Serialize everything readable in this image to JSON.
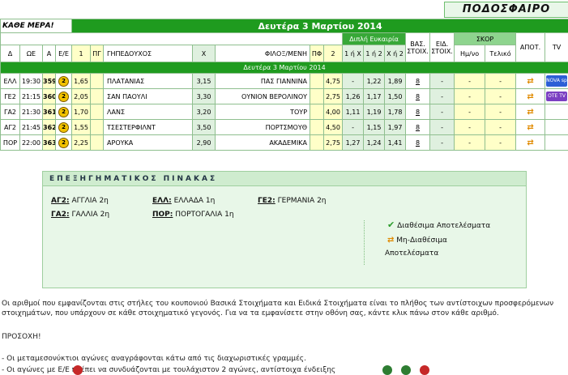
{
  "logo": "ΠΟΔΟΣΦΑΙΡΟ",
  "header": {
    "kathe_mera": "ΚΑΘΕ ΜΕΡΑ!",
    "title": "Δευτέρα 3 Μαρτίου 2014",
    "diplh": "Διπλή Ευκαιρία",
    "vas": "ΒΑΣ. ΣΤΟΙΧ.",
    "eid": "ΕΙΔ. ΣΤΟΙΧ.",
    "skor": "ΣΚΟΡ",
    "apot": "ΑΠΟΤ.",
    "tv": "TV",
    "date_row": "Δευτέρα 3 Μαρτίου 2014"
  },
  "columns": [
    "Δ",
    "ΩΕ",
    "Α",
    "Ε/Ε",
    "1",
    "ΠΓ",
    "ΓΗΠΕΔΟΥΧΟΣ",
    "Χ",
    "ΦΙΛΟΞ/ΜΕΝΗ",
    "ΠΦ",
    "2",
    "1 ή Χ",
    "1 ή 2",
    "Χ ή 2",
    "Ημ/νο",
    "Τελικό"
  ],
  "rows": [
    {
      "d": "ΕΛΛ",
      "time": "19:30",
      "code": "359",
      "ee": "2",
      "o1": "1,65",
      "home": "ΠΛΑΤΑΝΙΑΣ",
      "ox": "3,15",
      "away": "ΠΑΣ ΓΙΑΝΝΙΝΑ",
      "o2": "4,75",
      "dx1": "-",
      "d12": "1,22",
      "dx2": "1,89",
      "vas": "8",
      "eid": "-",
      "half": "-",
      "final": "-",
      "tv": "NOVA sports"
    },
    {
      "d": "ΓΕ2",
      "time": "21:15",
      "code": "360",
      "ee": "2",
      "o1": "2,05",
      "home": "ΣΑΝ ΠΑΟΥΛΙ",
      "ox": "3,30",
      "away": "ΟΥΝΙΟΝ ΒΕΡΟΛΙΝΟΥ",
      "o2": "2,75",
      "dx1": "1,26",
      "d12": "1,17",
      "dx2": "1,50",
      "vas": "8",
      "eid": "-",
      "half": "-",
      "final": "-",
      "tv": "OTE TV"
    },
    {
      "d": "ΓΑ2",
      "time": "21:30",
      "code": "361",
      "ee": "2",
      "o1": "1,70",
      "home": "ΛΑΝΣ",
      "ox": "3,20",
      "away": "ΤΟΥΡ",
      "o2": "4,00",
      "dx1": "1,11",
      "d12": "1,19",
      "dx2": "1,78",
      "vas": "8",
      "eid": "-",
      "half": "-",
      "final": "-",
      "tv": ""
    },
    {
      "d": "ΑΓ2",
      "time": "21:45",
      "code": "362",
      "ee": "2",
      "o1": "1,55",
      "home": "ΤΣΕΣΤΕΡΦΙΛΝΤ",
      "ox": "3,50",
      "away": "ΠΟΡΤΣΜΟΥΘ",
      "o2": "4,50",
      "dx1": "-",
      "d12": "1,15",
      "dx2": "1,97",
      "vas": "8",
      "eid": "-",
      "half": "-",
      "final": "-",
      "tv": ""
    },
    {
      "d": "ΠΟΡ",
      "time": "22:00",
      "code": "363",
      "ee": "2",
      "o1": "2,25",
      "home": "ΑΡΟΥΚΑ",
      "ox": "2,90",
      "away": "ΑΚΑΔΕΜΙΚΑ",
      "o2": "2,75",
      "dx1": "1,27",
      "d12": "1,24",
      "dx2": "1,41",
      "vas": "8",
      "eid": "-",
      "half": "-",
      "final": "-",
      "tv": ""
    }
  ],
  "legend": {
    "title": "ΕΠΕΞΗΓΗΜΑΤΙΚΟΣ ΠΙΝΑΚΑΣ",
    "entries": [
      {
        "code": "ΑΓ2:",
        "name": "ΑΓΓΛΙΑ 2η"
      },
      {
        "code": "ΕΛΛ:",
        "name": "ΕΛΛΑΔΑ 1η"
      },
      {
        "code": "ΓΕ2:",
        "name": "ΓΕΡΜΑΝΙΑ 2η"
      },
      {
        "code": "ΓΑ2:",
        "name": "ΓΑΛΛΙΑ 2η"
      },
      {
        "code": "ΠΟΡ:",
        "name": "ΠΟΡΤΟΓΑΛΙΑ 1η"
      }
    ],
    "available": "Διαθέσιμα Αποτελέσματα",
    "unavailable_1": "Μη-Διαθέσιμα",
    "unavailable_2": "Αποτελέσματα"
  },
  "text": {
    "p1": "Οι αριθμοί που εμφανίζονται στις στήλες του κουπονιού Βασικά Στοιχήματα και Ειδικά Στοιχήματα είναι το πλήθος των αντίστοιχων προσφερόμενων στοιχημάτων, που υπάρχουν σε κάθε στοιχηματικό γεγονός. Για να τα εμφανίσετε στην οθόνη σας, κάντε κλικ πάνω στον κάθε αριθμό.",
    "p2": "ΠΡΟΣΟΧΗ!",
    "p3": "- Οι μεταμεσονύκτιοι αγώνες αναγράφονται κάτω από τις διαχωριστικές γραμμές.",
    "p4": "- Οι αγώνες με Ε/Ε      πρέπει να συνδυάζονται με τουλάχιστον 2 αγώνες, αντίστοιχα ένδειξης"
  },
  "colors": {
    "green": "#1f9b1f",
    "yellow": "#ffffc8",
    "light_green": "#dff0df",
    "orange": "#e08a00"
  }
}
